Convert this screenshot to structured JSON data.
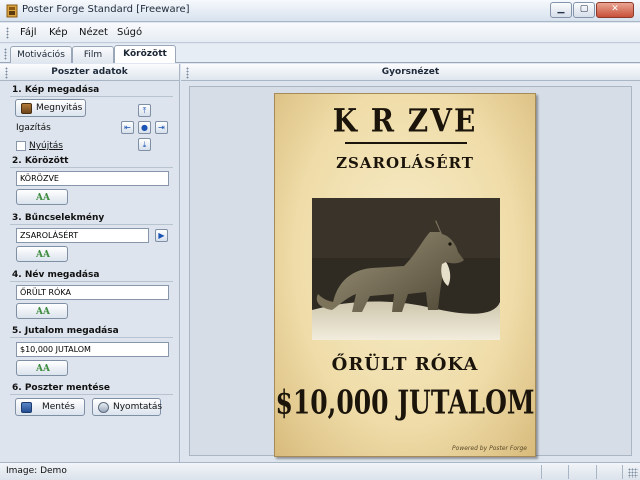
{
  "window": {
    "title": "Poster Forge Standard [Freeware]"
  },
  "menu": {
    "items": [
      "Fájl",
      "Kép",
      "Nézet",
      "Súgó"
    ]
  },
  "tabs": [
    {
      "label": "Motivációs",
      "active": false
    },
    {
      "label": "Film",
      "active": false
    },
    {
      "label": "Körözött",
      "active": true
    }
  ],
  "left_panel": {
    "title": "Poszter adatok",
    "sections": {
      "image": {
        "title": "1. Kép megadása",
        "open_button": "Megnyitás",
        "align_label": "Igazítás",
        "stretch_label": "Nyújtás",
        "stretch_checked": false
      },
      "wanted": {
        "title": "2. Körözött",
        "value": "KÖRÖZVE"
      },
      "crime": {
        "title": "3. Bűncselekmény",
        "value": "ZSAROLÁSÉRT"
      },
      "name": {
        "title": "4. Név megadása",
        "value": "ŐRÜLT RÓKA"
      },
      "reward": {
        "title": "5. Jutalom megadása",
        "value": "$10,000 JUTALOM"
      },
      "save": {
        "title": "6. Poszter mentése",
        "save_button": "Mentés",
        "print_button": "Nyomtatás"
      }
    }
  },
  "right_panel": {
    "title": "Gyorsnézet"
  },
  "poster": {
    "headline": "K R ZVE",
    "crime": "ZSAROLÁSÉRT",
    "name": "ŐRÜLT RÓKA",
    "reward": "$10,000 JUTALOM",
    "credit": "Powered by Poster Forge"
  },
  "status": {
    "text": "Image: Demo"
  },
  "colors": {
    "accent": "#1a55b5",
    "poster_paper": "#efdca8",
    "poster_ink": "#1b140b",
    "font_button_icon": "#3c8a3c"
  }
}
